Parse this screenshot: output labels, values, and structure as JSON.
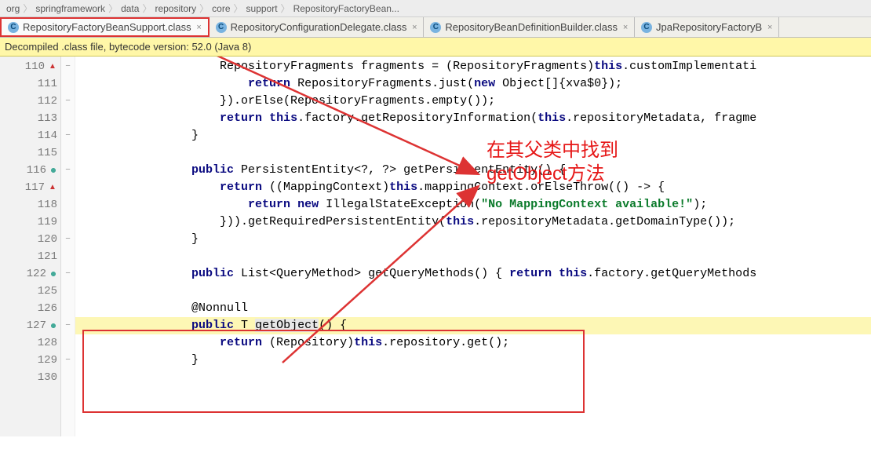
{
  "breadcrumb": [
    "org",
    "springframework",
    "data",
    "repository",
    "core",
    "support",
    "RepositoryFactoryBean..."
  ],
  "tabs": [
    {
      "label": "RepositoryFactoryBeanSupport.class",
      "active": true
    },
    {
      "label": "RepositoryConfigurationDelegate.class",
      "active": false
    },
    {
      "label": "RepositoryBeanDefinitionBuilder.class",
      "active": false
    },
    {
      "label": "JpaRepositoryFactoryB",
      "active": false
    }
  ],
  "banner": "Decompiled .class file, bytecode version: 52.0 (Java 8)",
  "annotation": {
    "line1": "在其父类中找到",
    "line2": "getObject方法"
  },
  "lines": [
    {
      "n": "110",
      "mark": "red-up",
      "fold": "−",
      "html": "                    RepositoryFragments fragments = (RepositoryFragments)<span class='kw'>this</span>.customImplementati"
    },
    {
      "n": "111",
      "mark": "",
      "fold": "",
      "html": "                        <span class='kw'>return</span> RepositoryFragments.just(<span class='kw'>new</span> Object[]{xva$0});"
    },
    {
      "n": "112",
      "mark": "",
      "fold": "−",
      "html": "                    }).orElse(RepositoryFragments.empty());"
    },
    {
      "n": "113",
      "mark": "",
      "fold": "",
      "html": "                    <span class='kw'>return</span> <span class='kw'>this</span>.factory.getRepositoryInformation(<span class='kw'>this</span>.repositoryMetadata, fragme"
    },
    {
      "n": "114",
      "mark": "",
      "fold": "−",
      "html": "                }"
    },
    {
      "n": "115",
      "mark": "",
      "fold": "",
      "html": ""
    },
    {
      "n": "116",
      "mark": "green",
      "fold": "−",
      "html": "                <span class='kw'>public</span> PersistentEntity&lt;?, ?&gt; getPersistentEntity() {"
    },
    {
      "n": "117",
      "mark": "red-up",
      "fold": "",
      "html": "                    <span class='kw'>return</span> ((MappingContext)<span class='kw'>this</span>.mappingContext.orElseThrow(() -&gt; {"
    },
    {
      "n": "118",
      "mark": "",
      "fold": "",
      "html": "                        <span class='kw'>return</span> <span class='kw'>new</span> IllegalStateException(<span class='str'>\"No MappingContext available!\"</span>);"
    },
    {
      "n": "119",
      "mark": "",
      "fold": "",
      "html": "                    })).getRequiredPersistentEntity(<span class='kw'>this</span>.repositoryMetadata.getDomainType());"
    },
    {
      "n": "120",
      "mark": "",
      "fold": "−",
      "html": "                }"
    },
    {
      "n": "121",
      "mark": "",
      "fold": "",
      "html": ""
    },
    {
      "n": "122",
      "mark": "green",
      "fold": "−",
      "html": "                <span class='kw'>public</span> List&lt;QueryMethod&gt; getQueryMethods() { <span class='kw'>return</span> <span class='kw'>this</span>.factory.getQueryMethods"
    },
    {
      "n": "125",
      "mark": "",
      "fold": "",
      "html": ""
    },
    {
      "n": "126",
      "mark": "",
      "fold": "",
      "html": "                @Nonnull"
    },
    {
      "n": "127",
      "mark": "green",
      "fold": "−",
      "html": "                <span class='kw'>public</span> T <span style='background:#e7e7e7;'>getObject</span>() {",
      "hl": true
    },
    {
      "n": "128",
      "mark": "",
      "fold": "",
      "html": "                    <span class='kw'>return</span> (Repository)<span class='kw'>this</span>.repository.get();"
    },
    {
      "n": "129",
      "mark": "",
      "fold": "−",
      "html": "                }"
    },
    {
      "n": "130",
      "mark": "",
      "fold": "",
      "html": ""
    }
  ]
}
